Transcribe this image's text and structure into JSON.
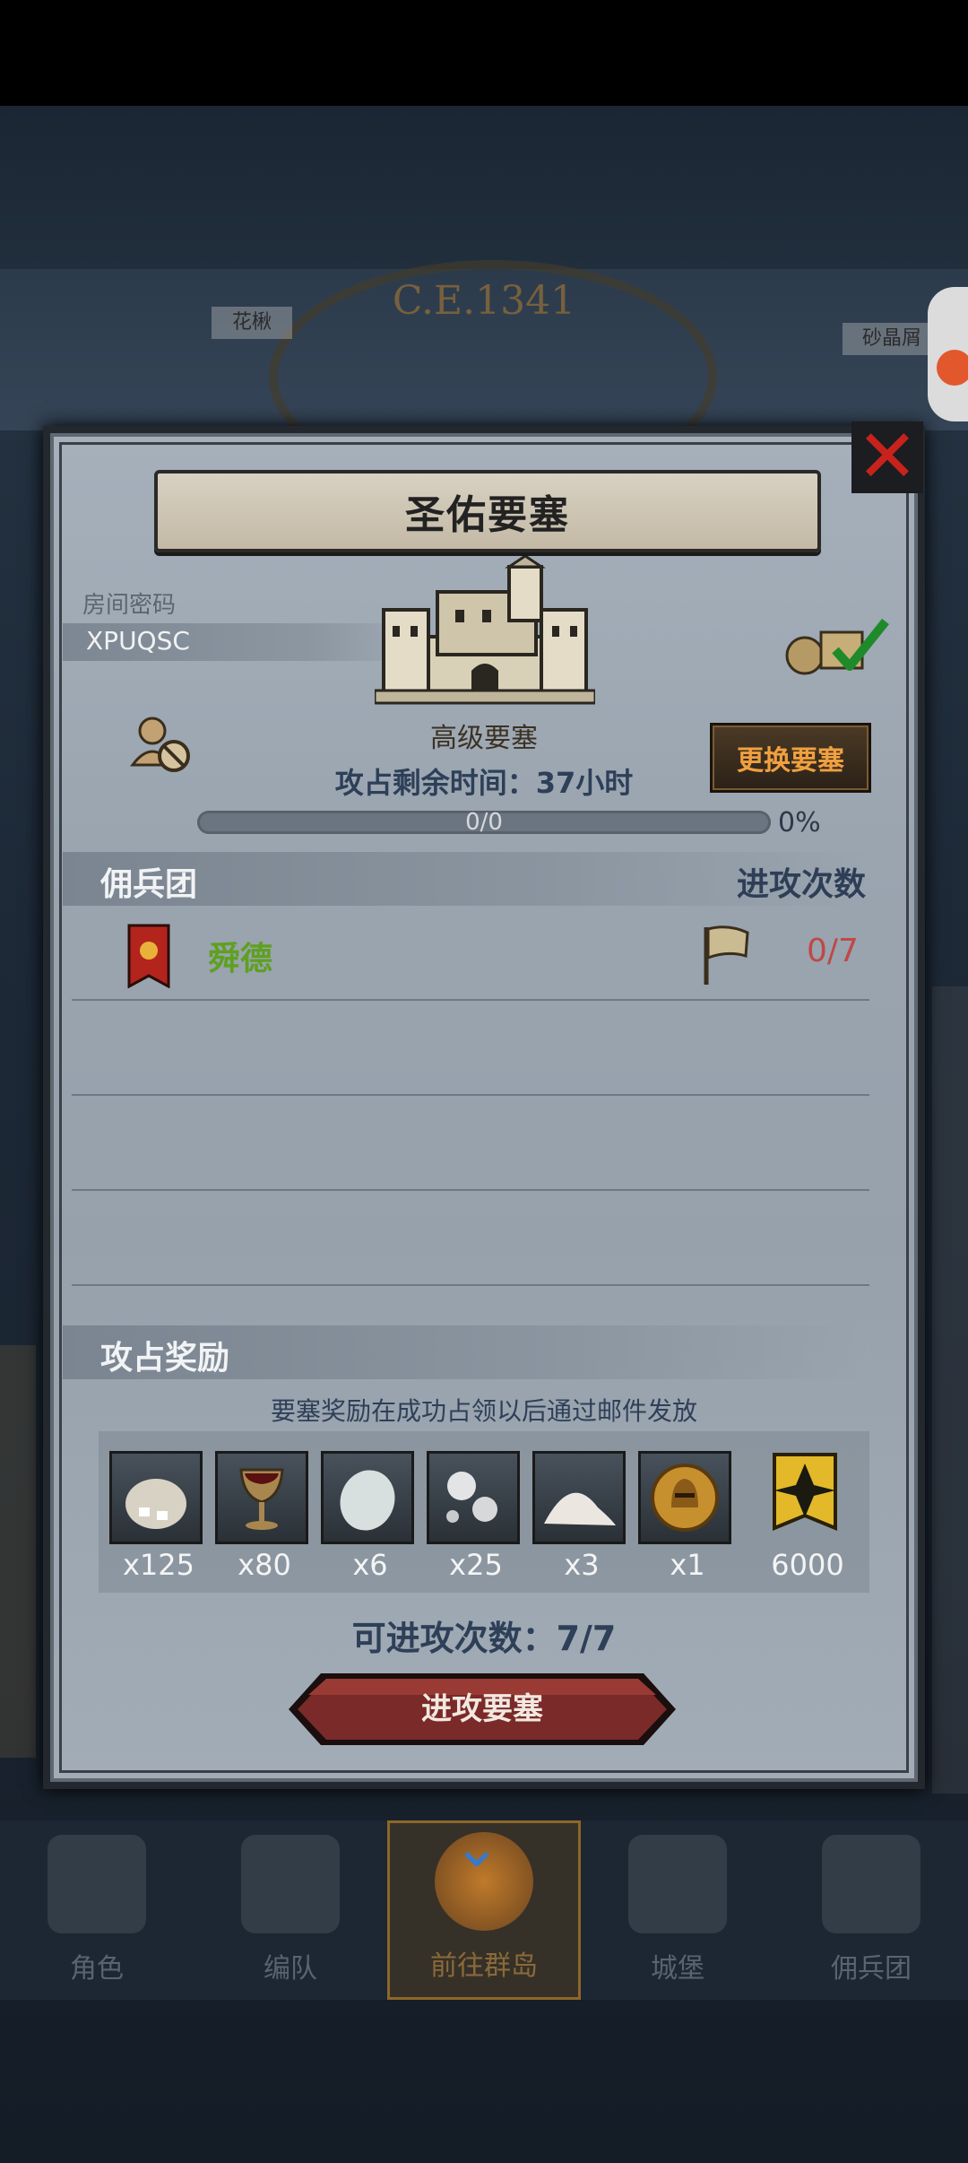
{
  "background": {
    "year": "C.E.1341",
    "chip_left": "花楸",
    "chip_right": "砂晶屑"
  },
  "modal": {
    "title": "圣佑要塞",
    "close_icon": "close-x-icon",
    "room_label": "房间密码",
    "room_code": "XPUQSC",
    "fortress_type": "高级要塞",
    "change_button": "更换要塞",
    "remaining_time": "攻占剩余时间：37小时",
    "progress": {
      "label": "0/0",
      "percent_text": "0%",
      "fraction": 0
    },
    "mercenary_header": "佣兵团",
    "attack_count_header": "进攻次数",
    "mercenaries": [
      {
        "name": "舜德",
        "attacks": "0/7"
      }
    ],
    "reward_header": "攻占奖励",
    "reward_note": "要塞奖励在成功占领以后通过邮件发放",
    "rewards": [
      {
        "icon": "sack-icon",
        "qty": "x125"
      },
      {
        "icon": "goblet-icon",
        "qty": "x80"
      },
      {
        "icon": "stone-icon",
        "qty": "x6"
      },
      {
        "icon": "silver-orbs-icon",
        "qty": "x25"
      },
      {
        "icon": "powder-pile-icon",
        "qty": "x3"
      },
      {
        "icon": "helmet-coin-icon",
        "qty": "x1"
      },
      {
        "icon": "rank-badge-icon",
        "qty": "6000"
      }
    ],
    "attack_left": "可进攻次数：7/7",
    "attack_button": "进攻要塞"
  },
  "nav": [
    {
      "label": "角色",
      "icon": "knight-icon"
    },
    {
      "label": "编队",
      "icon": "formation-icon"
    },
    {
      "label": "前往群岛",
      "icon": "globe-icon",
      "active": true
    },
    {
      "label": "城堡",
      "icon": "castle-icon"
    },
    {
      "label": "佣兵团",
      "icon": "mercenary-icon"
    }
  ],
  "colors": {
    "title_text": "#222222",
    "change_button_text": "#f0a040",
    "merc_name": "#5fa021",
    "attack_count": "#c04848",
    "close_x": "#c8221d"
  }
}
